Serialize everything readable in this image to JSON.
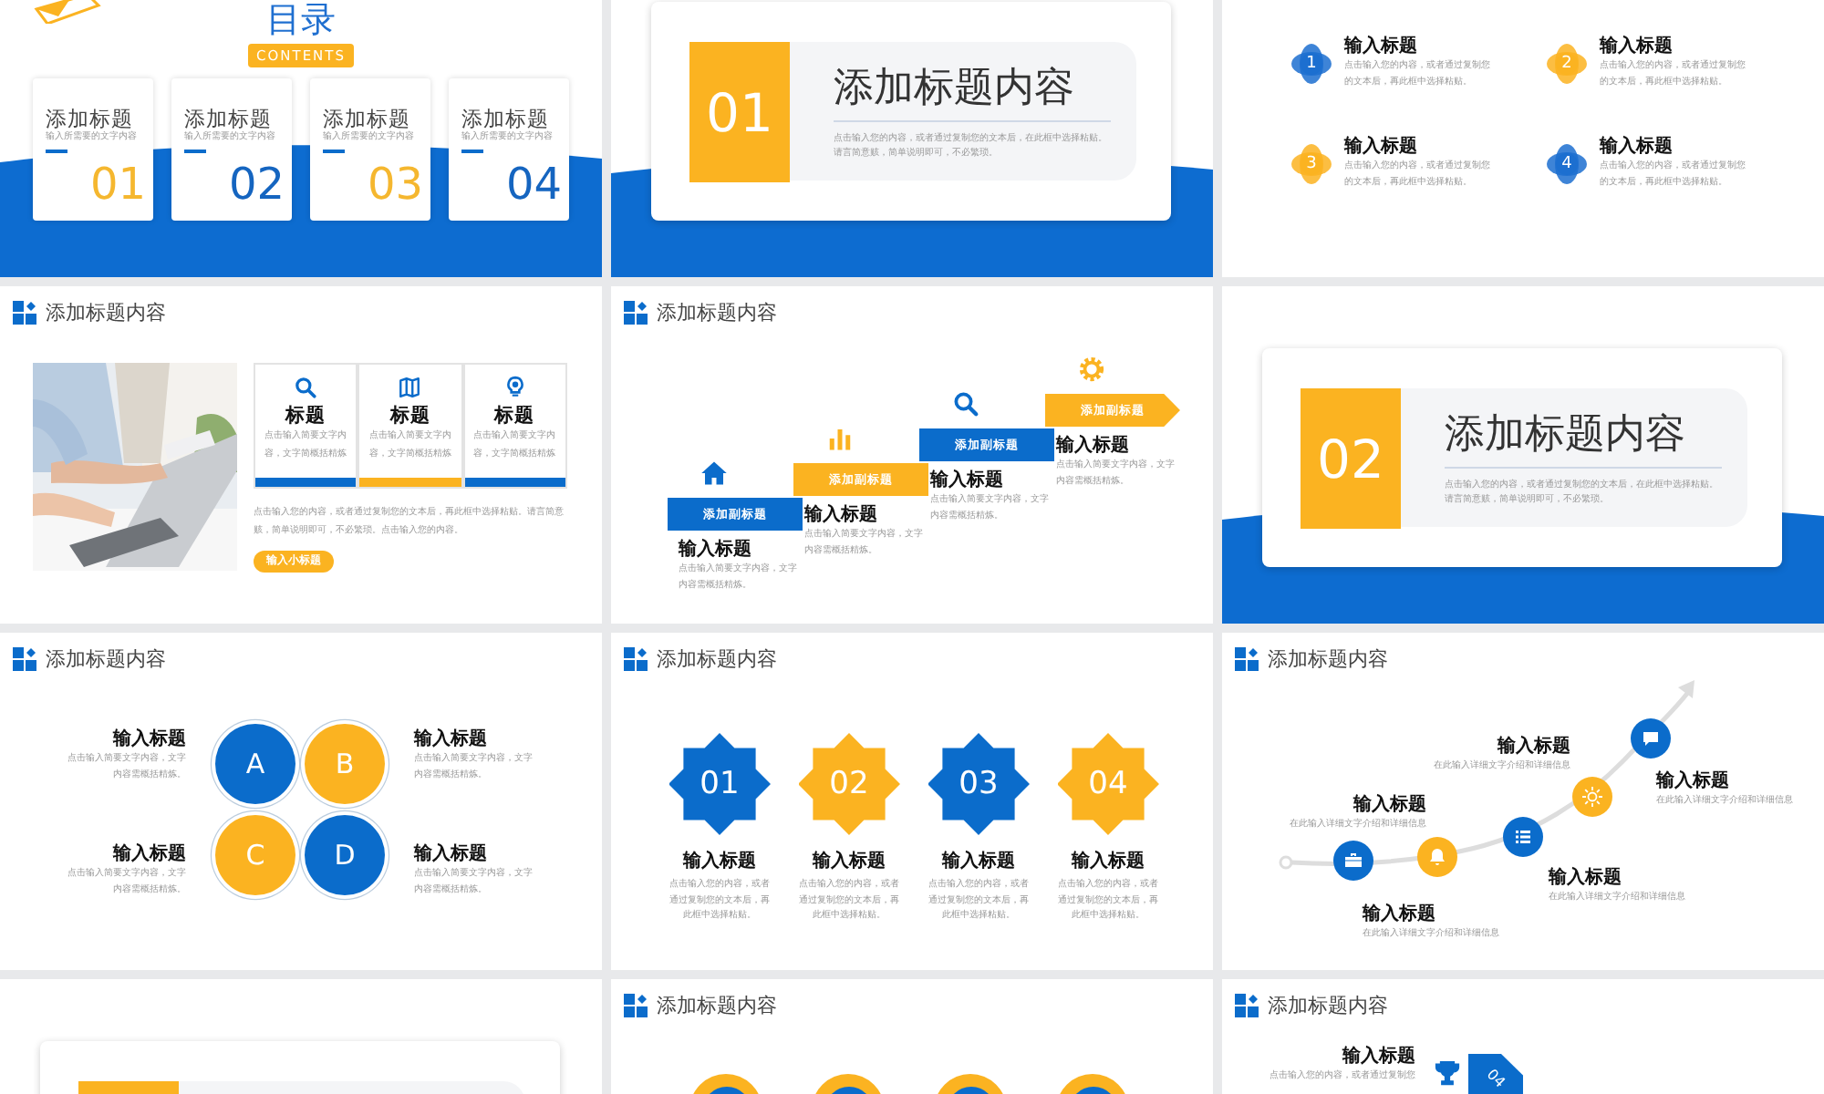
{
  "slides": [
    {
      "kind": "contents",
      "title": "目录",
      "badge": "CONTENTS",
      "items": [
        {
          "title": "添加标题",
          "subtitle": "输入所需要的文字内容",
          "number": "01",
          "color": "#f5b72f"
        },
        {
          "title": "添加标题",
          "subtitle": "输入所需要的文字内容",
          "number": "02",
          "color": "#1565c0"
        },
        {
          "title": "添加标题",
          "subtitle": "输入所需要的文字内容",
          "number": "03",
          "color": "#f5b72f"
        },
        {
          "title": "添加标题",
          "subtitle": "输入所需要的文字内容",
          "number": "04",
          "color": "#1565c0"
        }
      ]
    },
    {
      "kind": "section",
      "number": "01",
      "title": "添加标题内容",
      "body": "点击输入您的内容，或者通过复制您的文本后，在此框中选择粘贴。请言简意赅，简单说明即可，不必繁琐。"
    },
    {
      "kind": "points",
      "items": [
        {
          "number": "1",
          "title": "输入标题",
          "body": "点击输入您的内容，或者通过复制您的文本后，再此框中选择粘贴。",
          "color": "#1c6fd0"
        },
        {
          "number": "2",
          "title": "输入标题",
          "body": "点击输入您的内容，或者通过复制您的文本后，再此框中选择粘贴。",
          "color": "#fbb321"
        },
        {
          "number": "3",
          "title": "输入标题",
          "body": "点击输入您的内容，或者通过复制您的文本后，再此框中选择粘贴。",
          "color": "#fbb321"
        },
        {
          "number": "4",
          "title": "输入标题",
          "body": "点击输入您的内容，或者通过复制您的文本后，再此框中选择粘贴。",
          "color": "#1c6fd0"
        }
      ]
    },
    {
      "kind": "photo_cards",
      "header": "添加标题内容",
      "cards": [
        {
          "title": "标题",
          "body": "点击输入简要文字内容，文字简概括精炼",
          "color": "#0b6ccb"
        },
        {
          "title": "标题",
          "body": "点击输入简要文字内容，文字简概括精炼",
          "color": "#fbb321"
        },
        {
          "title": "标题",
          "body": "点击输入简要文字内容，文字简概括精炼",
          "color": "#0b6ccb"
        }
      ],
      "paragraph": "点击输入您的内容，或者通过复制您的文本后，再此框中选择粘贴。请言简意赅，简单说明即可，不必繁琐。点击输入您的内容。",
      "button": "输入小标题"
    },
    {
      "kind": "stairs",
      "header": "添加标题内容",
      "steps": [
        {
          "label": "添加副标题",
          "title": "输入标题",
          "body": "点击输入简要文字内容，文字内容需概括精炼。",
          "color": "#0b6ccb"
        },
        {
          "label": "添加副标题",
          "title": "输入标题",
          "body": "点击输入简要文字内容，文字内容需概括精炼。",
          "color": "#fbb321"
        },
        {
          "label": "添加副标题",
          "title": "输入标题",
          "body": "点击输入简要文字内容，文字内容需概括精炼。",
          "color": "#0b6ccb"
        },
        {
          "label": "添加副标题",
          "title": "输入标题",
          "body": "点击输入简要文字内容，文字内容需概括精炼。",
          "color": "#fbb321"
        }
      ]
    },
    {
      "kind": "section",
      "number": "02",
      "title": "添加标题内容",
      "body": "点击输入您的内容，或者通过复制您的文本后，在此框中选择粘贴。请言简意赅，简单说明即可，不必繁琐。"
    },
    {
      "kind": "quadrants",
      "header": "添加标题内容",
      "items": [
        {
          "letter": "A",
          "title": "输入标题",
          "body": "点击输入简要文字内容，文字内容需概括精炼。",
          "color": "#0b6ccb"
        },
        {
          "letter": "B",
          "title": "输入标题",
          "body": "点击输入简要文字内容，文字内容需概括精炼。",
          "color": "#fbb321"
        },
        {
          "letter": "C",
          "title": "输入标题",
          "body": "点击输入简要文字内容，文字内容需概括精炼。",
          "color": "#fbb321"
        },
        {
          "letter": "D",
          "title": "输入标题",
          "body": "点击输入简要文字内容，文字内容需概括精炼。",
          "color": "#0b6ccb"
        }
      ]
    },
    {
      "kind": "stars",
      "header": "添加标题内容",
      "items": [
        {
          "number": "01",
          "title": "输入标题",
          "body": "点击输入您的内容，或者通过复制您的文本后，再此框中选择粘贴。",
          "color": "#0b6ccb"
        },
        {
          "number": "02",
          "title": "输入标题",
          "body": "点击输入您的内容，或者通过复制您的文本后，再此框中选择粘贴。",
          "color": "#fbb321"
        },
        {
          "number": "03",
          "title": "输入标题",
          "body": "点击输入您的内容，或者通过复制您的文本后，再此框中选择粘贴。",
          "color": "#0b6ccb"
        },
        {
          "number": "04",
          "title": "输入标题",
          "body": "点击输入您的内容，或者通过复制您的文本后，再此框中选择粘贴。",
          "color": "#fbb321"
        }
      ]
    },
    {
      "kind": "timeline",
      "header": "添加标题内容",
      "points": [
        {
          "title": "输入标题",
          "body": "在此输入详细文字介绍和详细信息",
          "color": "#0b6ccb"
        },
        {
          "title": "输入标题",
          "body": "在此输入详细文字介绍和详细信息",
          "color": "#fbb321"
        },
        {
          "title": "输入标题",
          "body": "在此输入详细文字介绍和详细信息",
          "color": "#0b6ccb"
        },
        {
          "title": "输入标题",
          "body": "在此输入详细文字介绍和详细信息",
          "color": "#fbb321"
        },
        {
          "title": "输入标题",
          "body": "在此输入详细文字介绍和详细信息",
          "color": "#0b6ccb"
        }
      ]
    },
    {
      "kind": "section_cut"
    },
    {
      "kind": "rings",
      "header": "添加标题内容"
    },
    {
      "kind": "trophy",
      "header": "添加标题内容",
      "title": "输入标题",
      "body": "点击输入您的内容，或者通过复制您",
      "tag": "04"
    }
  ]
}
